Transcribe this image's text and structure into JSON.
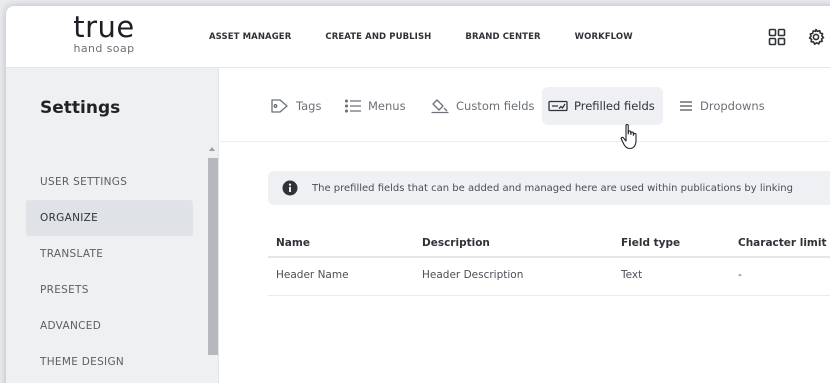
{
  "brand": {
    "name": "true",
    "tagline": "hand soap"
  },
  "topnav": [
    "ASSET MANAGER",
    "CREATE AND PUBLISH",
    "BRAND CENTER",
    "WORKFLOW"
  ],
  "top_icons": [
    "apps-grid-icon",
    "gear-icon"
  ],
  "sidebar": {
    "title": "Settings",
    "items": [
      "USER SETTINGS",
      "ORGANIZE",
      "TRANSLATE",
      "PRESETS",
      "ADVANCED",
      "THEME DESIGN"
    ],
    "active": "ORGANIZE"
  },
  "tabs": [
    {
      "label": "Tags",
      "icon": "tag-icon"
    },
    {
      "label": "Menus",
      "icon": "list-icon"
    },
    {
      "label": "Custom fields",
      "icon": "custom-fields-icon"
    },
    {
      "label": "Prefilled fields",
      "icon": "prefilled-field-icon",
      "active": true
    },
    {
      "label": "Dropdowns",
      "icon": "menu-lines-icon"
    }
  ],
  "info": {
    "icon": "info-icon",
    "text": "The prefilled fields that can be added and managed here are used within publications by linking"
  },
  "table": {
    "headers": [
      "Name",
      "Description",
      "Field type",
      "Character limit"
    ],
    "rows": [
      [
        "Header Name",
        "Header Description",
        "Text",
        "-"
      ]
    ]
  },
  "colors": {
    "accent": "#dfe3e8",
    "sidebar_bg": "#eef0f2",
    "tab_active_bg": "#eef0f3"
  }
}
